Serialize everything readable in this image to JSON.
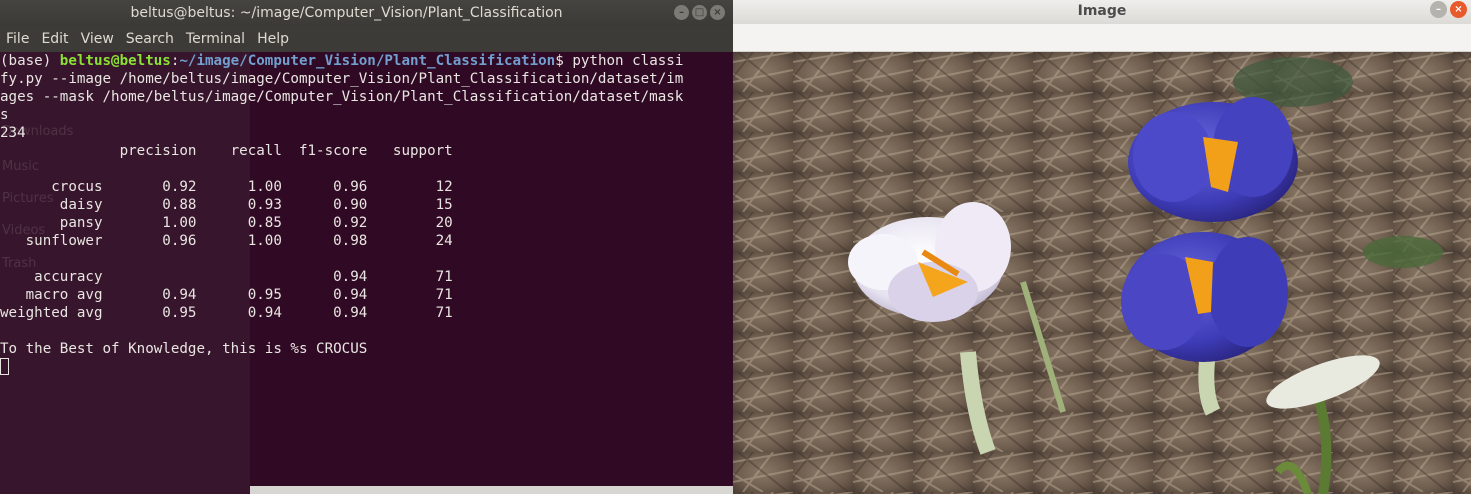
{
  "terminal": {
    "title": "beltus@beltus: ~/image/Computer_Vision/Plant_Classification",
    "menu": [
      "File",
      "Edit",
      "View",
      "Search",
      "Terminal",
      "Help"
    ],
    "prompt_prefix": "(base) ",
    "prompt_user": "beltus@beltus",
    "prompt_colon": ":",
    "prompt_path": "~/image/Computer_Vision/Plant_Classification",
    "prompt_cmd": "$ python classi",
    "lines": [
      "fy.py --image /home/beltus/image/Computer_Vision/Plant_Classification/dataset/im",
      "ages --mask /home/beltus/image/Computer_Vision/Plant_Classification/dataset/mask",
      "s",
      "234",
      "              precision    recall  f1-score   support",
      "",
      "      crocus       0.92      1.00      0.96        12",
      "       daisy       0.88      0.93      0.90        15",
      "       pansy       1.00      0.85      0.92        20",
      "   sunflower       0.96      1.00      0.98        24",
      "",
      "    accuracy                           0.94        71",
      "   macro avg       0.94      0.95      0.94        71",
      "weighted avg       0.95      0.94      0.94        71",
      "",
      "To the Best of Knowledge, this is %s CROCUS"
    ],
    "ghost_items": [
      "Downloads",
      "Music",
      "Pictures",
      "Videos",
      "Trash"
    ]
  },
  "image_window": {
    "title": "Image"
  }
}
